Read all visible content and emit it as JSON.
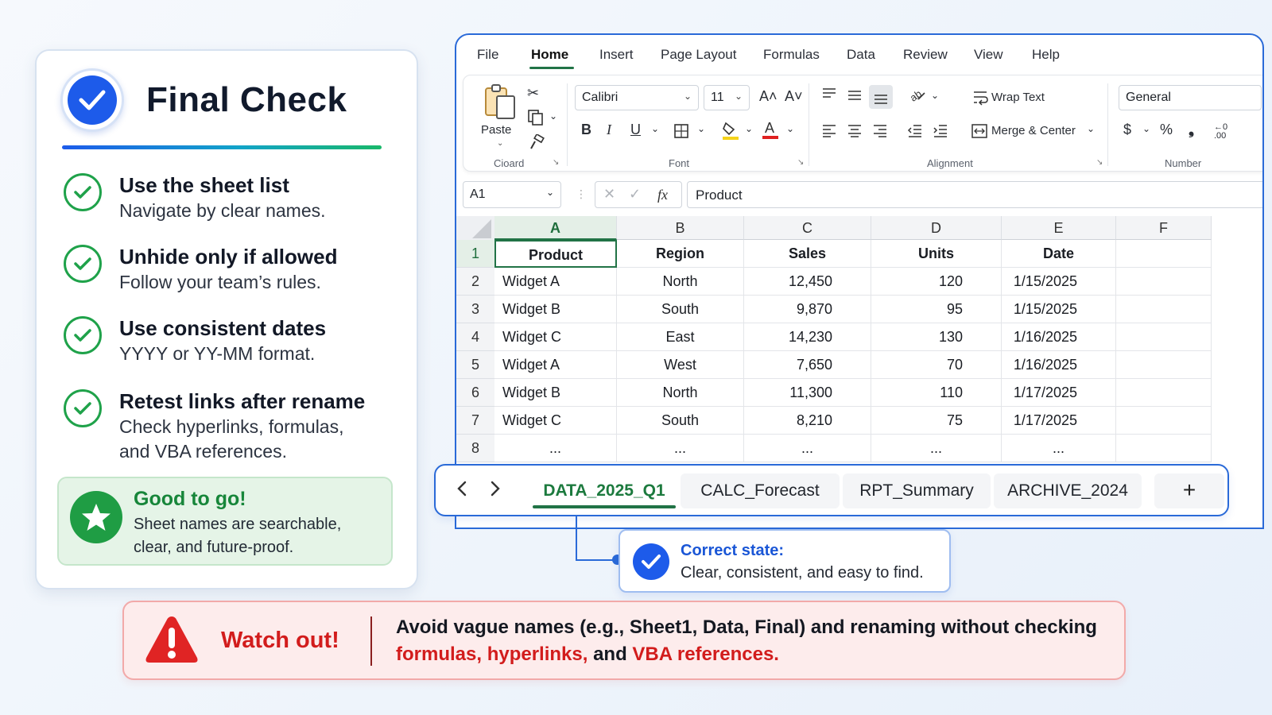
{
  "checklist": {
    "title": "Final Check",
    "items": [
      {
        "title": "Use the sheet list",
        "desc1": "Navigate by clear names.",
        "desc2": ""
      },
      {
        "title": "Unhide only if allowed",
        "desc1": "Follow your team’s rules.",
        "desc2": ""
      },
      {
        "title": "Use consistent dates",
        "desc1": "YYYY or YY-MM format.",
        "desc2": ""
      },
      {
        "title": "Retest links after rename",
        "desc1": "Check hyperlinks, formulas,",
        "desc2": "and VBA references."
      }
    ],
    "good": {
      "title": "Good to go!",
      "desc1": "Sheet names are searchable,",
      "desc2": "clear, and future-proof."
    }
  },
  "excel": {
    "menu": [
      "File",
      "Home",
      "Insert",
      "Page Layout",
      "Formulas",
      "Data",
      "Review",
      "View",
      "Help"
    ],
    "active_menu": "Home",
    "ribbon": {
      "paste_label": "Paste",
      "clipboard_label": "Cioard",
      "font_name": "Calibri",
      "font_size": "11",
      "grow_font": "A˄",
      "shrink_font": "A˅",
      "bold": "B",
      "italic": "I",
      "underline": "U",
      "font_group_label": "Font",
      "wrap_text": "Wrap Text",
      "merge_center": "Merge & Center",
      "alignment_group_label": "Alignment",
      "number_format": "General",
      "currency": "$",
      "percent": "%",
      "comma": "ஞ",
      "number_group_label": "Number"
    },
    "formula_bar": {
      "name_box": "A1",
      "fx": "fx",
      "content": "Product"
    },
    "columns": [
      "A",
      "B",
      "C",
      "D",
      "E",
      "F"
    ],
    "rows": [
      {
        "n": "1",
        "cells": [
          "Product",
          "Region",
          "Sales",
          "Units",
          "Date",
          ""
        ]
      },
      {
        "n": "2",
        "cells": [
          "Widget A",
          "North",
          "12,450",
          "120",
          "1/15/2025",
          ""
        ]
      },
      {
        "n": "3",
        "cells": [
          "Widget B",
          "South",
          "9,870",
          "95",
          "1/15/2025",
          ""
        ]
      },
      {
        "n": "4",
        "cells": [
          "Widget C",
          "East",
          "14,230",
          "130",
          "1/16/2025",
          ""
        ]
      },
      {
        "n": "5",
        "cells": [
          "Widget A",
          "West",
          "7,650",
          "70",
          "1/16/2025",
          ""
        ]
      },
      {
        "n": "6",
        "cells": [
          "Widget B",
          "North",
          "11,300",
          "110",
          "1/17/2025",
          ""
        ]
      },
      {
        "n": "7",
        "cells": [
          "Widget C",
          "South",
          "8,210",
          "75",
          "1/17/2025",
          ""
        ]
      },
      {
        "n": "8",
        "cells": [
          "...",
          "...",
          "...",
          "...",
          "...",
          ""
        ]
      }
    ],
    "sheet_tabs": [
      "DATA_2025_Q1",
      "CALC_Forecast",
      "RPT_Summary",
      "ARCHIVE_2024"
    ],
    "active_tab": "DATA_2025_Q1",
    "add_sheet": "+",
    "nav_prev": "‹",
    "nav_next": "›"
  },
  "callout": {
    "title": "Correct state:",
    "desc": "Clear, consistent, and easy to find."
  },
  "watch_out": {
    "title": "Watch out!",
    "line1": "Avoid vague names (e.g., Sheet1, Data, Final) and renaming without checking",
    "line2_part1": "formulas, hyperlinks,",
    "line2_part2": " and ",
    "line2_part3": "VBA references."
  },
  "colors": {
    "accent_blue": "#1d5bea",
    "excel_green": "#217346",
    "success_green": "#1f9d44",
    "warning_red": "#d21c1c"
  }
}
